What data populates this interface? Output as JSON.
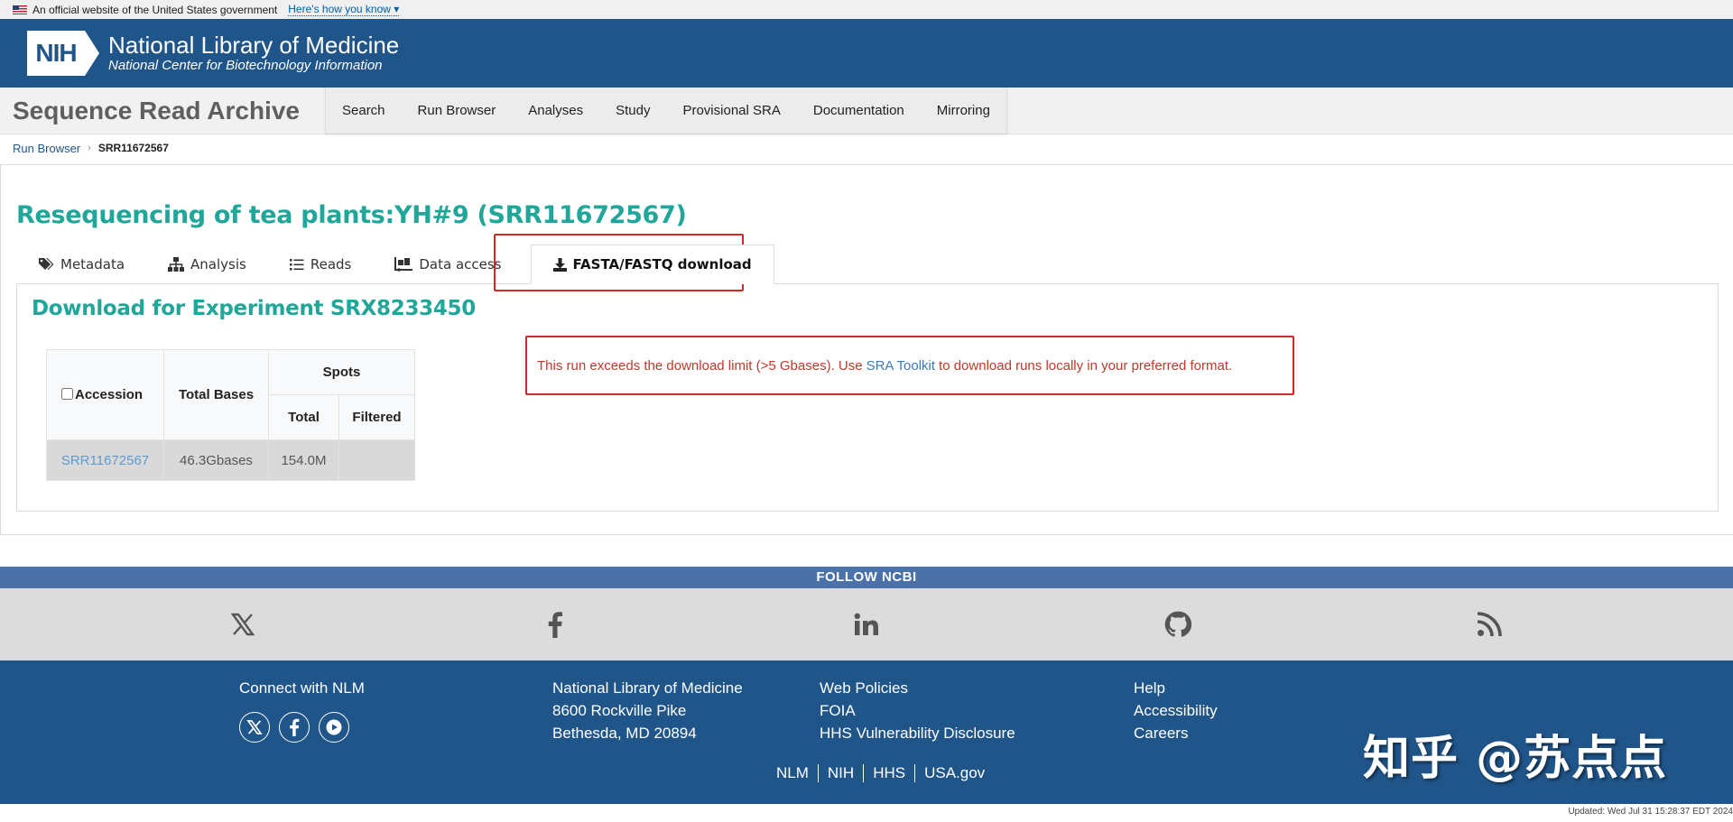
{
  "gov_banner": {
    "text": "An official website of the United States government",
    "link": "Here's how you know"
  },
  "header": {
    "logo": "NIH",
    "title": "National Library of Medicine",
    "subtitle": "National Center for Biotechnology Information"
  },
  "sra": {
    "title": "Sequence Read Archive",
    "nav": [
      "Search",
      "Run Browser",
      "Analyses",
      "Study",
      "Provisional SRA",
      "Documentation",
      "Mirroring"
    ]
  },
  "breadcrumb": {
    "link": "Run Browser",
    "current": "SRR11672567"
  },
  "main": {
    "title": "Resequencing of tea plants:YH#9 (SRR11672567)",
    "tabs": [
      {
        "label": "Metadata",
        "icon": "tags-icon"
      },
      {
        "label": "Analysis",
        "icon": "sitemap-icon"
      },
      {
        "label": "Reads",
        "icon": "list-icon"
      },
      {
        "label": "Data access",
        "icon": "truck-loading-icon"
      },
      {
        "label": "FASTA/FASTQ download",
        "icon": "download-icon",
        "active": true
      }
    ],
    "download_title": "Download for Experiment SRX8233450",
    "table": {
      "headers": {
        "accession": "Accession",
        "total_bases": "Total Bases",
        "spots": "Spots",
        "total": "Total",
        "filtered": "Filtered"
      },
      "row": {
        "accession": "SRR11672567",
        "total_bases": "46.3Gbases",
        "total": "154.0M",
        "filtered": ""
      }
    },
    "alert": {
      "before": "This run exceeds the download limit (>5 Gbases). Use",
      "link": "SRA Toolkit",
      "after": "to download runs locally in your preferred format.",
      "color": "#c0392b"
    }
  },
  "follow": {
    "title": "FOLLOW NCBI",
    "icons": [
      "x-twitter-icon",
      "facebook-icon",
      "linkedin-icon",
      "github-icon",
      "rss-icon"
    ]
  },
  "footer": {
    "connect": "Connect with NLM",
    "address": [
      "National Library of Medicine",
      "8600 Rockville Pike",
      "Bethesda, MD 20894"
    ],
    "policies": [
      "Web Policies",
      "FOIA",
      "HHS Vulnerability Disclosure"
    ],
    "help": [
      "Help",
      "Accessibility",
      "Careers"
    ],
    "bottom_links": [
      "NLM",
      "NIH",
      "HHS",
      "USA.gov"
    ],
    "watermark": "知乎 @苏点点"
  },
  "updated": "Updated: Wed Jul 31 15:28:37 EDT 2024",
  "colors": {
    "header_blue": "#20558a",
    "teal": "#21a69a",
    "highlight_red": "#d62728"
  }
}
